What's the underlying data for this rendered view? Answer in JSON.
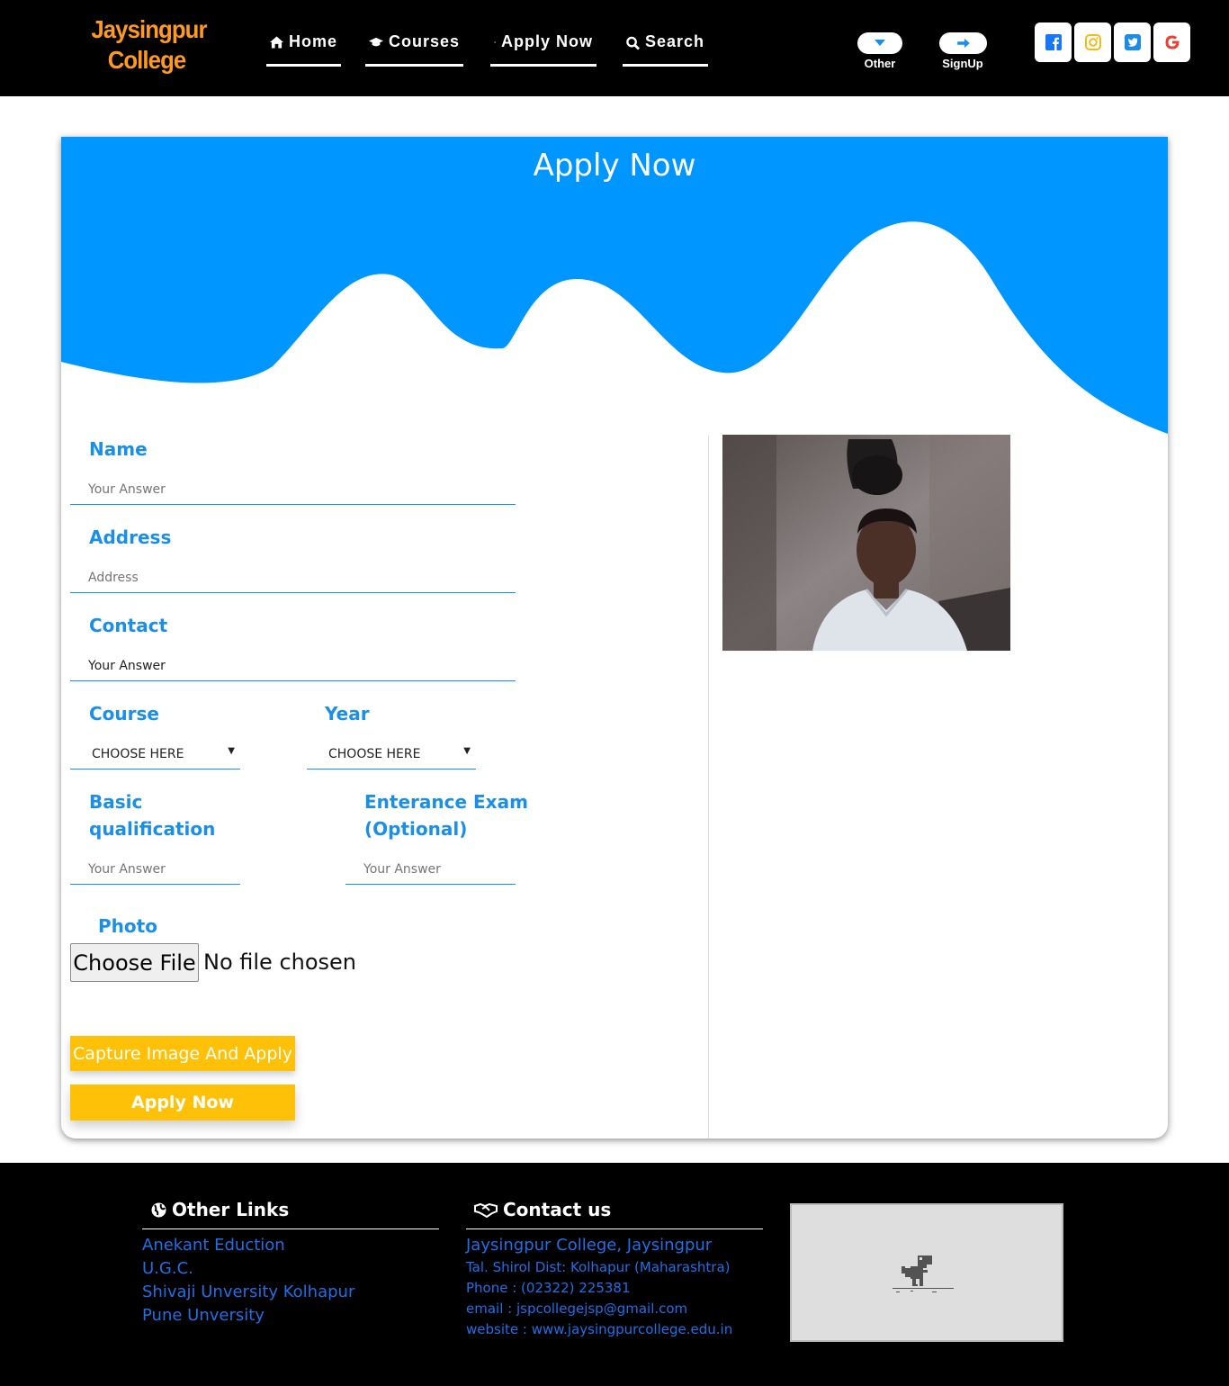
{
  "brand": {
    "line1": "Jaysingpur",
    "line2": "College"
  },
  "nav": {
    "home": "Home",
    "courses": "Courses",
    "apply": "Apply Now",
    "search": "Search",
    "other": "Other",
    "signup": "SignUp"
  },
  "social": [
    "facebook-icon",
    "instagram-icon",
    "twitter-icon",
    "google-icon"
  ],
  "form": {
    "title": "Apply Now",
    "name_label": "Name",
    "name_placeholder": "Your Answer",
    "address_label": "Address",
    "address_placeholder": "Address",
    "contact_label": "Contact",
    "contact_value": "Your Answer",
    "course_label": "Course",
    "course_value": "CHOOSE HERE",
    "year_label": "Year",
    "year_value": "CHOOSE HERE",
    "basic_label_1": "Basic",
    "basic_label_2": "qualification",
    "basic_placeholder": "Your Answer",
    "exam_label_1": "Enterance Exam",
    "exam_label_2": "(Optional)",
    "exam_placeholder": "Your Answer",
    "photo_label": "Photo",
    "choose_file": "Choose File",
    "no_file": "No file chosen",
    "capture_button": "Capture Image And Apply",
    "apply_button": "Apply Now"
  },
  "footer": {
    "links_heading": "Other Links",
    "links": [
      "Anekant Eduction",
      "U.G.C.",
      "Shivaji Unversity Kolhapur",
      "Pune Unversity"
    ],
    "contact_heading": "Contact us",
    "contact_name": "Jaysingpur College, Jaysingpur",
    "contact_address": "Tal. Shirol Dist: Kolhapur (Maharashtra)",
    "contact_phone": "Phone : (02322) 225381",
    "contact_email": "email : jspcollegejsp@gmail.com",
    "contact_website": "website : www.jaysingpurcollege.edu.in"
  },
  "colors": {
    "header_bg": "#000000",
    "brand": "#ff9a1f",
    "accent_blue": "#0096ff",
    "label_blue": "#1a8fea",
    "button_yellow": "#ffc107",
    "link_blue": "#1f6fe6"
  }
}
